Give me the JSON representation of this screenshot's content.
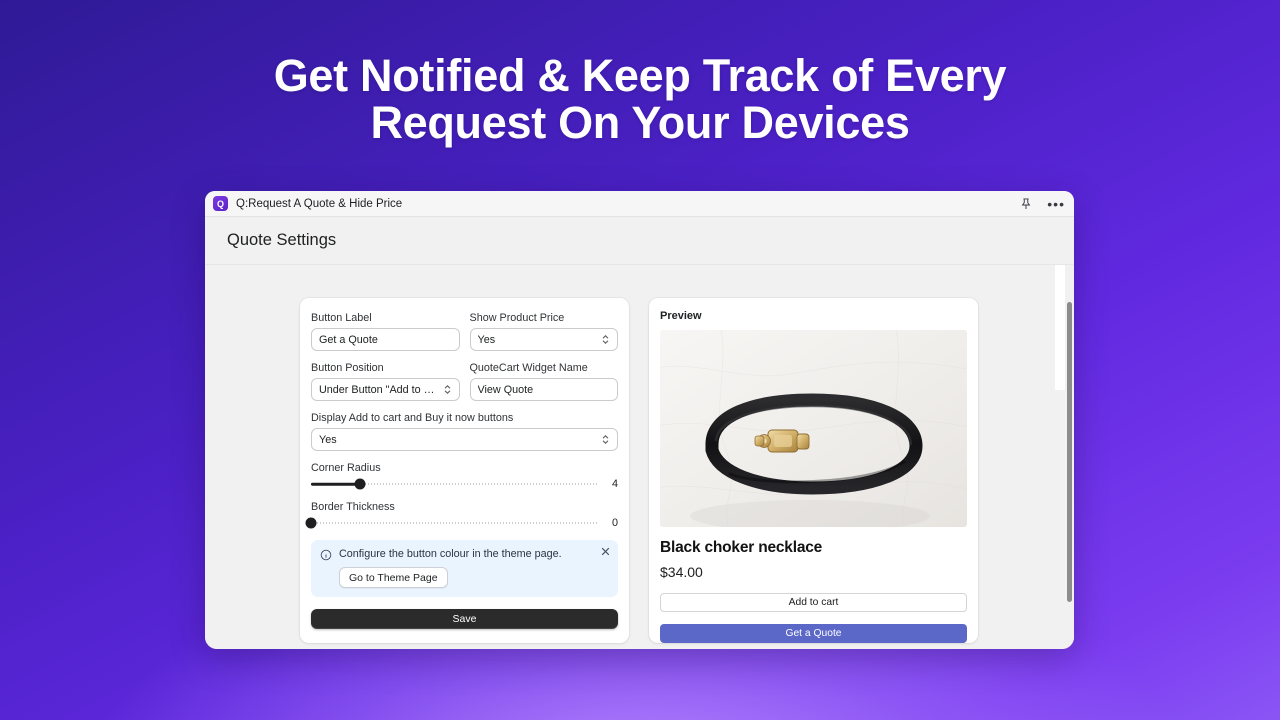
{
  "theme": {
    "bg_dark": "#2f1a96",
    "bg_mid": "#6129e0",
    "bg_light": "#a472f5",
    "accent_purple": "#5b23c8",
    "quote_button": "#5b68c8",
    "banner_bg": "#eaf4ff",
    "save_button": "#2b2b2b"
  },
  "headline": {
    "line1": "Get Notified & Keep Track of Every",
    "line2": "Request On Your Devices"
  },
  "window": {
    "titlebar": {
      "app_icon_glyph": "Q",
      "app_icon_name": "app-icon-q",
      "title": "Q:Request A Quote & Hide Price",
      "pin_icon": "pushpin-icon",
      "more_icon": "more-options-icon"
    },
    "page_title": "Quote Settings"
  },
  "settings": {
    "fields": [
      {
        "label": "Button Label",
        "value": "Get a Quote",
        "type": "text"
      },
      {
        "label": "Show Product Price",
        "value": "Yes",
        "type": "select"
      },
      {
        "label": "Button Position",
        "value": "Under Button \"Add to Ca...",
        "type": "select"
      },
      {
        "label": "QuoteCart Widget Name",
        "value": "View Quote",
        "type": "text"
      },
      {
        "label": "Display Add to cart and Buy it now buttons",
        "value": "Yes",
        "type": "select"
      }
    ],
    "sliders": [
      {
        "label": "Corner Radius",
        "value": "4",
        "percent": 17
      },
      {
        "label": "Border Thickness",
        "value": "0",
        "percent": 0
      }
    ],
    "banner": {
      "icon": "info-circle-icon",
      "text": "Configure the button colour in the theme page.",
      "action_label": "Go to Theme Page",
      "close_icon": "close-icon"
    },
    "save_label": "Save"
  },
  "preview": {
    "panel_title": "Preview",
    "image_alt": "black-choker-necklace-on-white-marble",
    "product_name": "Black choker necklace",
    "product_price": "$34.00",
    "add_to_cart_label": "Add to cart",
    "get_quote_label": "Get a Quote"
  }
}
